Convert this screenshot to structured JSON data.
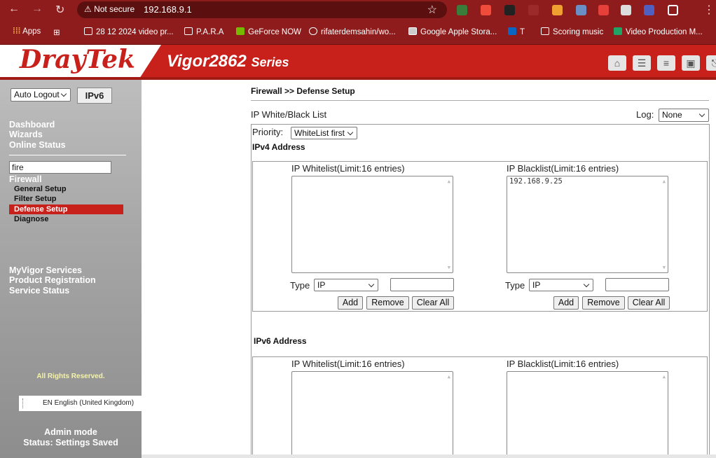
{
  "browser": {
    "security_label": "Not secure",
    "url": "192.168.9.1",
    "bookmarks": [
      {
        "label": "Apps"
      },
      {
        "label": "28 12 2024 video pr..."
      },
      {
        "label": "P.A.R.A"
      },
      {
        "label": "GeForce NOW"
      },
      {
        "label": "rifaterdemsahin/wo..."
      },
      {
        "label": "Google Apple Stora..."
      },
      {
        "label": "T"
      },
      {
        "label": "Scoring music"
      },
      {
        "label": "Video Production M..."
      }
    ]
  },
  "banner": {
    "logo": "DrayTek",
    "model": "Vigor2862",
    "model_suffix": "Series"
  },
  "sidebar": {
    "auto_logout": "Auto Logout",
    "ipv6_badge": "IPv6",
    "menu": [
      "Dashboard",
      "Wizards",
      "Online Status"
    ],
    "filter_value": "fire",
    "firewall": "Firewall",
    "firewall_items": [
      "General Setup",
      "Filter Setup",
      "Defense Setup",
      "Diagnose"
    ],
    "services": [
      "MyVigor Services",
      "Product Registration",
      "Service Status"
    ],
    "rights": "All Rights Reserved.",
    "language": "EN English (United Kingdom)",
    "admin_mode": "Admin mode",
    "status": "Status: Settings Saved"
  },
  "content": {
    "breadcrumb": "Firewall >> Defense Setup",
    "list_title": "IP White/Black List",
    "log_label": "Log:",
    "log_value": "None",
    "priority_label": "Priority:",
    "priority_value": "WhiteList first",
    "ipv4_title": "IPv4 Address",
    "ipv6_title": "IPv6 Address",
    "whitelist_label": "IP Whitelist(Limit:16 entries)",
    "blacklist_label": "IP Blacklist(Limit:16 entries)",
    "ipv4_whitelist_entries": "",
    "ipv4_blacklist_entries": "192.168.9.25",
    "type_label": "Type",
    "type_value": "IP",
    "add": "Add",
    "remove": "Remove",
    "clear_all": "Clear All"
  }
}
